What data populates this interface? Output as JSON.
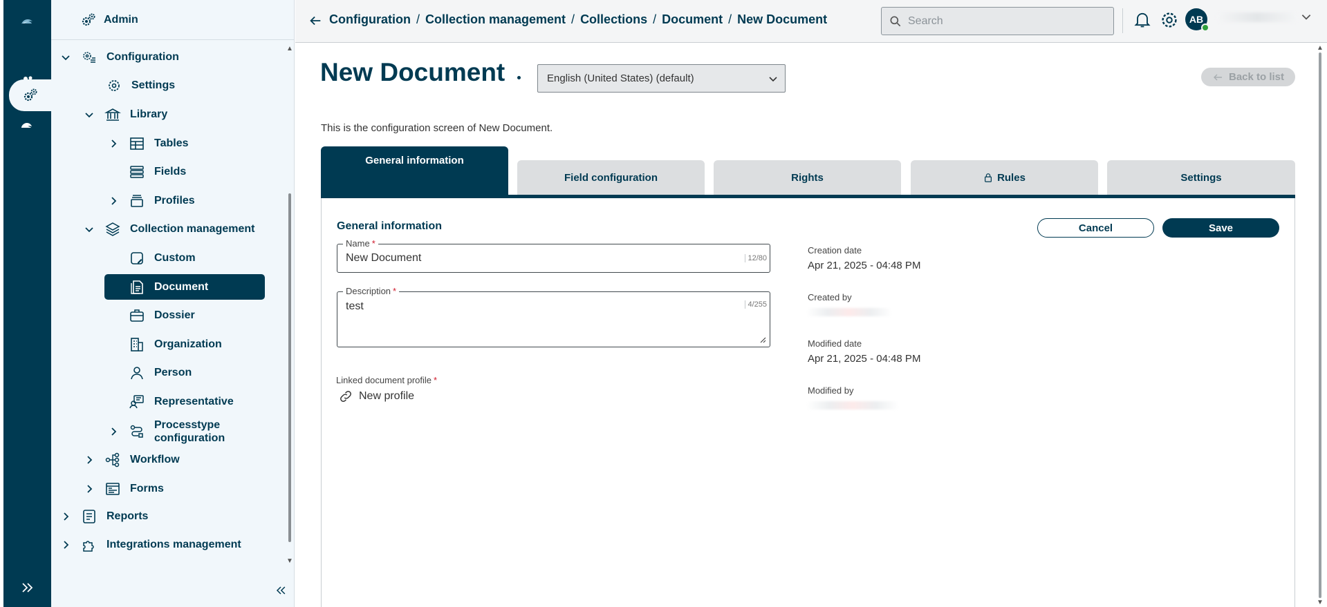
{
  "colors": {
    "primary": "#003a52",
    "sidebar_bg": "#f1f7fb",
    "tab_inactive": "#dcdee0",
    "required": "#d01b2c",
    "presence_online": "#2e9e3b"
  },
  "rail": {
    "items": [
      {
        "icon": "cloud-logo-icon"
      },
      {
        "icon": "cloud-people-icon"
      },
      {
        "icon": "gears-icon",
        "active": true
      },
      {
        "icon": "cloud-hand-icon"
      },
      {
        "icon": "expand-double-chevron-icon"
      }
    ]
  },
  "sidebar": {
    "header": {
      "label": "Admin",
      "icon": "gears-icon"
    },
    "items": [
      {
        "label": "Configuration",
        "icon": "settings-list-icon",
        "expanded": true
      },
      {
        "label": "Settings",
        "icon": "gear-icon"
      },
      {
        "label": "Library",
        "icon": "library-icon",
        "expanded": true
      },
      {
        "label": "Tables",
        "icon": "table-icon",
        "expanded": false
      },
      {
        "label": "Fields",
        "icon": "fields-icon"
      },
      {
        "label": "Profiles",
        "icon": "profiles-icon",
        "expanded": false
      },
      {
        "label": "Collection management",
        "icon": "layers-icon",
        "expanded": true
      },
      {
        "label": "Custom",
        "icon": "custom-doc-icon"
      },
      {
        "label": "Document",
        "icon": "document-icon",
        "selected": true
      },
      {
        "label": "Dossier",
        "icon": "briefcase-icon"
      },
      {
        "label": "Organization",
        "icon": "building-icon"
      },
      {
        "label": "Person",
        "icon": "person-icon"
      },
      {
        "label": "Representative",
        "icon": "representative-icon"
      },
      {
        "label_line1": "Processtype",
        "label_line2": "configuration",
        "icon": "process-icon",
        "expanded": false
      },
      {
        "label": "Workflow",
        "icon": "workflow-icon",
        "expanded": false
      },
      {
        "label": "Forms",
        "icon": "forms-icon",
        "expanded": false
      },
      {
        "label": "Reports",
        "icon": "reports-icon",
        "expanded": false
      },
      {
        "label": "Integrations management",
        "icon": "puzzle-icon",
        "expanded": false
      }
    ]
  },
  "topbar": {
    "breadcrumb": [
      "Configuration",
      "Collection management",
      "Collections",
      "Document",
      "New Document"
    ],
    "separator": "/",
    "search_placeholder": "Search",
    "avatar_initials": "AB"
  },
  "page": {
    "title": "New Document",
    "language": "English (United States) (default)",
    "back_to_list": "Back to list",
    "description": "This is the configuration screen of New Document."
  },
  "tabs": [
    {
      "label": "General information",
      "active": true
    },
    {
      "label": "Field configuration"
    },
    {
      "label": "Rights"
    },
    {
      "label": "Rules",
      "icon": "lock-icon"
    },
    {
      "label": "Settings"
    }
  ],
  "form": {
    "section_title": "General information",
    "cancel_label": "Cancel",
    "save_label": "Save",
    "name": {
      "label": "Name",
      "value": "New Document",
      "counter": "12/80",
      "required_mark": "*"
    },
    "description": {
      "label": "Description",
      "value": "test",
      "counter": "4/255",
      "required_mark": "*"
    },
    "linked_profile": {
      "label": "Linked document profile",
      "value": "New profile",
      "required_mark": "*"
    }
  },
  "meta": {
    "creation_date_label": "Creation date",
    "creation_date": "Apr 21, 2025 - 04:48 PM",
    "created_by_label": "Created by",
    "modified_date_label": "Modified date",
    "modified_date": "Apr 21, 2025 - 04:48 PM",
    "modified_by_label": "Modified by"
  }
}
